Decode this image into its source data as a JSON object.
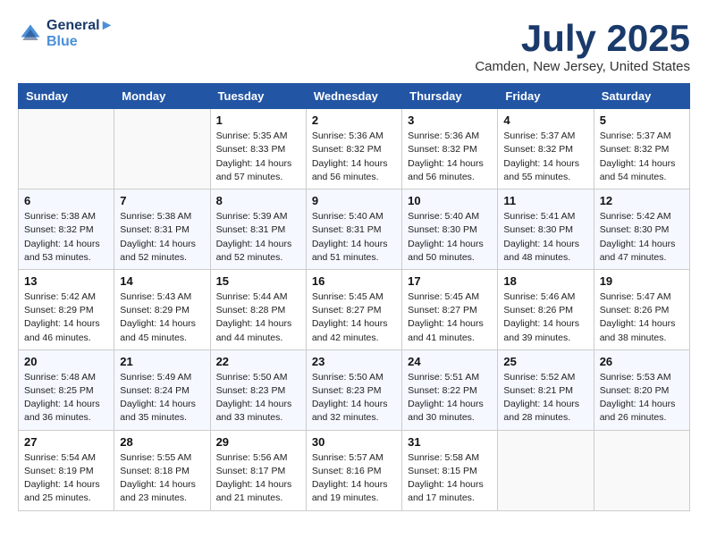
{
  "logo": {
    "line1": "General",
    "line2": "Blue"
  },
  "title": "July 2025",
  "location": "Camden, New Jersey, United States",
  "days_of_week": [
    "Sunday",
    "Monday",
    "Tuesday",
    "Wednesday",
    "Thursday",
    "Friday",
    "Saturday"
  ],
  "weeks": [
    [
      {
        "day": "",
        "info": ""
      },
      {
        "day": "",
        "info": ""
      },
      {
        "day": "1",
        "info": "Sunrise: 5:35 AM\nSunset: 8:33 PM\nDaylight: 14 hours and 57 minutes."
      },
      {
        "day": "2",
        "info": "Sunrise: 5:36 AM\nSunset: 8:32 PM\nDaylight: 14 hours and 56 minutes."
      },
      {
        "day": "3",
        "info": "Sunrise: 5:36 AM\nSunset: 8:32 PM\nDaylight: 14 hours and 56 minutes."
      },
      {
        "day": "4",
        "info": "Sunrise: 5:37 AM\nSunset: 8:32 PM\nDaylight: 14 hours and 55 minutes."
      },
      {
        "day": "5",
        "info": "Sunrise: 5:37 AM\nSunset: 8:32 PM\nDaylight: 14 hours and 54 minutes."
      }
    ],
    [
      {
        "day": "6",
        "info": "Sunrise: 5:38 AM\nSunset: 8:32 PM\nDaylight: 14 hours and 53 minutes."
      },
      {
        "day": "7",
        "info": "Sunrise: 5:38 AM\nSunset: 8:31 PM\nDaylight: 14 hours and 52 minutes."
      },
      {
        "day": "8",
        "info": "Sunrise: 5:39 AM\nSunset: 8:31 PM\nDaylight: 14 hours and 52 minutes."
      },
      {
        "day": "9",
        "info": "Sunrise: 5:40 AM\nSunset: 8:31 PM\nDaylight: 14 hours and 51 minutes."
      },
      {
        "day": "10",
        "info": "Sunrise: 5:40 AM\nSunset: 8:30 PM\nDaylight: 14 hours and 50 minutes."
      },
      {
        "day": "11",
        "info": "Sunrise: 5:41 AM\nSunset: 8:30 PM\nDaylight: 14 hours and 48 minutes."
      },
      {
        "day": "12",
        "info": "Sunrise: 5:42 AM\nSunset: 8:30 PM\nDaylight: 14 hours and 47 minutes."
      }
    ],
    [
      {
        "day": "13",
        "info": "Sunrise: 5:42 AM\nSunset: 8:29 PM\nDaylight: 14 hours and 46 minutes."
      },
      {
        "day": "14",
        "info": "Sunrise: 5:43 AM\nSunset: 8:29 PM\nDaylight: 14 hours and 45 minutes."
      },
      {
        "day": "15",
        "info": "Sunrise: 5:44 AM\nSunset: 8:28 PM\nDaylight: 14 hours and 44 minutes."
      },
      {
        "day": "16",
        "info": "Sunrise: 5:45 AM\nSunset: 8:27 PM\nDaylight: 14 hours and 42 minutes."
      },
      {
        "day": "17",
        "info": "Sunrise: 5:45 AM\nSunset: 8:27 PM\nDaylight: 14 hours and 41 minutes."
      },
      {
        "day": "18",
        "info": "Sunrise: 5:46 AM\nSunset: 8:26 PM\nDaylight: 14 hours and 39 minutes."
      },
      {
        "day": "19",
        "info": "Sunrise: 5:47 AM\nSunset: 8:26 PM\nDaylight: 14 hours and 38 minutes."
      }
    ],
    [
      {
        "day": "20",
        "info": "Sunrise: 5:48 AM\nSunset: 8:25 PM\nDaylight: 14 hours and 36 minutes."
      },
      {
        "day": "21",
        "info": "Sunrise: 5:49 AM\nSunset: 8:24 PM\nDaylight: 14 hours and 35 minutes."
      },
      {
        "day": "22",
        "info": "Sunrise: 5:50 AM\nSunset: 8:23 PM\nDaylight: 14 hours and 33 minutes."
      },
      {
        "day": "23",
        "info": "Sunrise: 5:50 AM\nSunset: 8:23 PM\nDaylight: 14 hours and 32 minutes."
      },
      {
        "day": "24",
        "info": "Sunrise: 5:51 AM\nSunset: 8:22 PM\nDaylight: 14 hours and 30 minutes."
      },
      {
        "day": "25",
        "info": "Sunrise: 5:52 AM\nSunset: 8:21 PM\nDaylight: 14 hours and 28 minutes."
      },
      {
        "day": "26",
        "info": "Sunrise: 5:53 AM\nSunset: 8:20 PM\nDaylight: 14 hours and 26 minutes."
      }
    ],
    [
      {
        "day": "27",
        "info": "Sunrise: 5:54 AM\nSunset: 8:19 PM\nDaylight: 14 hours and 25 minutes."
      },
      {
        "day": "28",
        "info": "Sunrise: 5:55 AM\nSunset: 8:18 PM\nDaylight: 14 hours and 23 minutes."
      },
      {
        "day": "29",
        "info": "Sunrise: 5:56 AM\nSunset: 8:17 PM\nDaylight: 14 hours and 21 minutes."
      },
      {
        "day": "30",
        "info": "Sunrise: 5:57 AM\nSunset: 8:16 PM\nDaylight: 14 hours and 19 minutes."
      },
      {
        "day": "31",
        "info": "Sunrise: 5:58 AM\nSunset: 8:15 PM\nDaylight: 14 hours and 17 minutes."
      },
      {
        "day": "",
        "info": ""
      },
      {
        "day": "",
        "info": ""
      }
    ]
  ]
}
